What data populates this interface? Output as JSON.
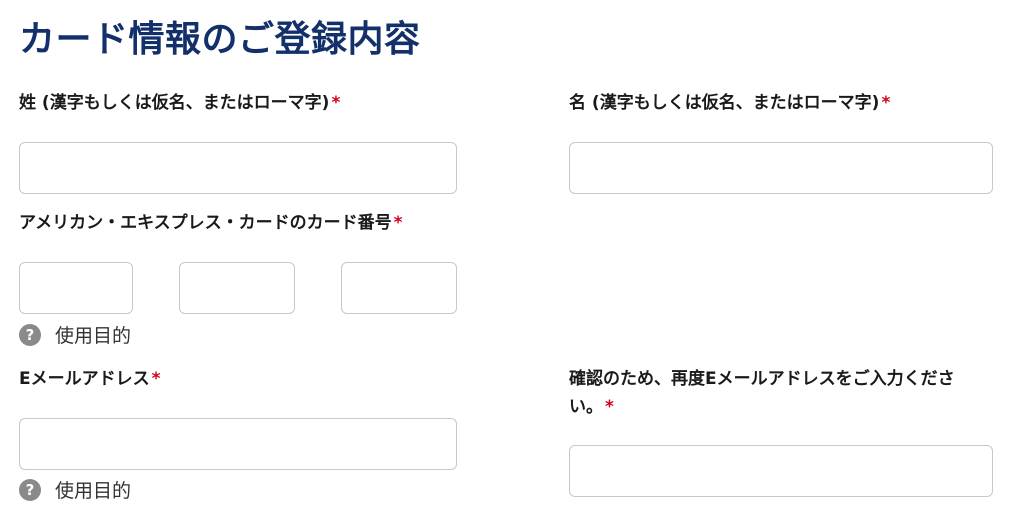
{
  "page": {
    "title": "カード情報のご登録内容"
  },
  "form": {
    "last_name": {
      "label": "姓 (漢字もしくは仮名、またはローマ字)",
      "required_mark": "*",
      "value": "",
      "placeholder": ""
    },
    "first_name": {
      "label": "名 (漢字もしくは仮名、またはローマ字)",
      "required_mark": "*",
      "value": "",
      "placeholder": ""
    },
    "card_number": {
      "label": "アメリカン・エキスプレス・カードのカード番号",
      "required_mark": "*",
      "segments": [
        "",
        "",
        ""
      ],
      "help_text": "使用目的",
      "help_icon": "question-icon"
    },
    "email": {
      "label": "Eメールアドレス",
      "required_mark": "*",
      "value": "",
      "help_text": "使用目的",
      "help_icon": "question-icon"
    },
    "email_confirm": {
      "label_line1": "確認のため、再度Eメールアドレスをご入力くださ",
      "label_line2": "い。",
      "required_mark": "*",
      "value": ""
    }
  },
  "colors": {
    "title": "#13306b",
    "required": "#d6001c",
    "input_border": "#c8c8c8",
    "help_icon_bg": "#8a8a8a"
  }
}
